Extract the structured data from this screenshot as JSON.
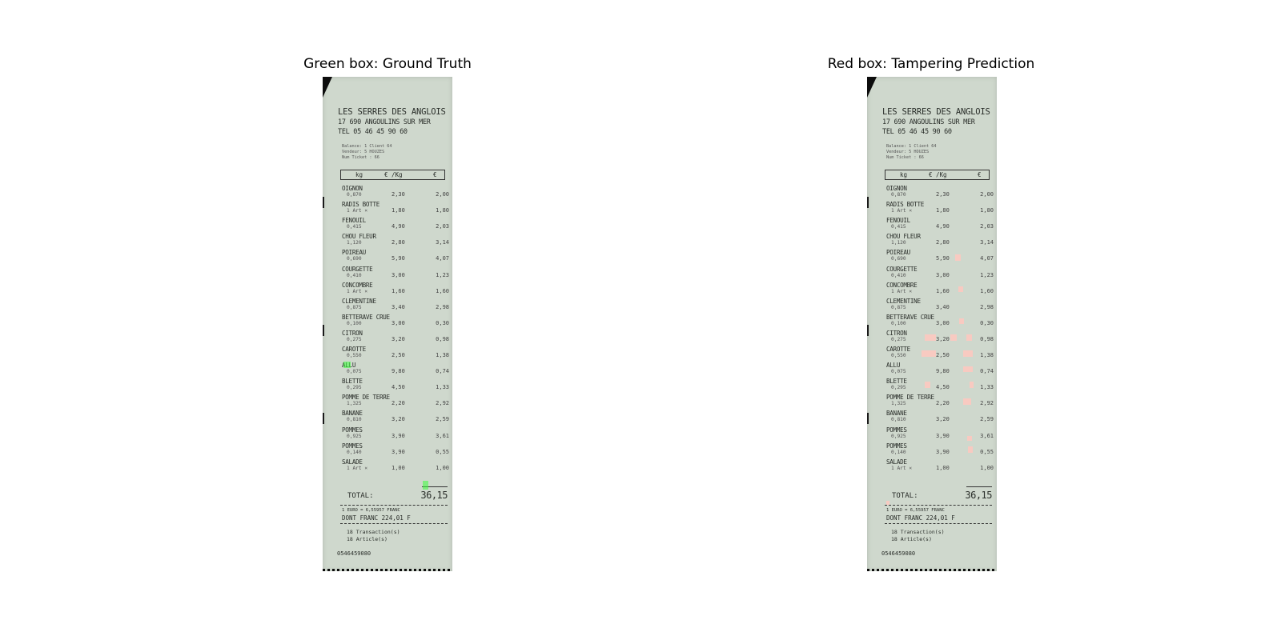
{
  "panels": {
    "left_title": "Green box: Ground Truth",
    "right_title": "Red box: Tampering Prediction"
  },
  "receipt": {
    "store_name": "LES SERRES DES ANGLOIS",
    "address": "17 690 ANGOULINS SUR MER",
    "tel": "TEL 05 46 45 90 60",
    "meta_line1": "Balance: 1   Client   64",
    "meta_line2": "Vendeur: 5 HOUZES",
    "meta_line3": "Num Ticket :   66",
    "columns": [
      "kg",
      "€ /Kg",
      "€"
    ],
    "items": [
      {
        "name": "OIGNON",
        "qty": "0,870",
        "price": "2,30",
        "amount": "2,00"
      },
      {
        "name": "RADIS BOTTE",
        "qty": "1 Art ×",
        "price": "1,80",
        "amount": "1,80"
      },
      {
        "name": "FENOUIL",
        "qty": "0,415",
        "price": "4,90",
        "amount": "2,03"
      },
      {
        "name": "CHOU FLEUR",
        "qty": "1,120",
        "price": "2,80",
        "amount": "3,14"
      },
      {
        "name": "POIREAU",
        "qty": "0,690",
        "price": "5,90",
        "amount": "4,07"
      },
      {
        "name": "COURGETTE",
        "qty": "0,410",
        "price": "3,00",
        "amount": "1,23"
      },
      {
        "name": "CONCOMBRE",
        "qty": "1 Art ×",
        "price": "1,60",
        "amount": "1,60"
      },
      {
        "name": "CLEMENTINE",
        "qty": "0,875",
        "price": "3,40",
        "amount": "2,98"
      },
      {
        "name": "BETTERAVE CRUE",
        "qty": "0,100",
        "price": "3,00",
        "amount": "0,30"
      },
      {
        "name": "CITRON",
        "qty": "0,275",
        "price": "3,20",
        "amount": "0,98"
      },
      {
        "name": "CAROTTE",
        "qty": "0,550",
        "price": "2,50",
        "amount": "1,38"
      },
      {
        "name": "ALLU",
        "qty": "0,075",
        "price": "9,80",
        "amount": "0,74"
      },
      {
        "name": "BLETTE",
        "qty": "0,295",
        "price": "4,50",
        "amount": "1,33"
      },
      {
        "name": "POMME DE TERRE",
        "qty": "1,325",
        "price": "2,20",
        "amount": "2,92"
      },
      {
        "name": "BANANE",
        "qty": "0,810",
        "price": "3,20",
        "amount": "2,59"
      },
      {
        "name": "POMMES",
        "qty": "0,925",
        "price": "3,90",
        "amount": "3,61"
      },
      {
        "name": "POMMES",
        "qty": "0,140",
        "price": "3,90",
        "amount": "0,55"
      },
      {
        "name": "SALADE",
        "qty": "1 Art ×",
        "price": "1,00",
        "amount": "1,00"
      }
    ],
    "total_label": "TOTAL:",
    "total_value": "36,15",
    "euro_rate": "1 EURO = 6,55957 FRANC",
    "franc_total": "DONT FRANC   224,01   F",
    "transactions": "18 Transaction(s)",
    "articles": "18 Article(s)",
    "phone": "0546459080"
  },
  "colors": {
    "receipt_paper": "#cfd8cd",
    "ground_truth_box": "#3cff3c",
    "prediction_box": "#ffc8be"
  }
}
